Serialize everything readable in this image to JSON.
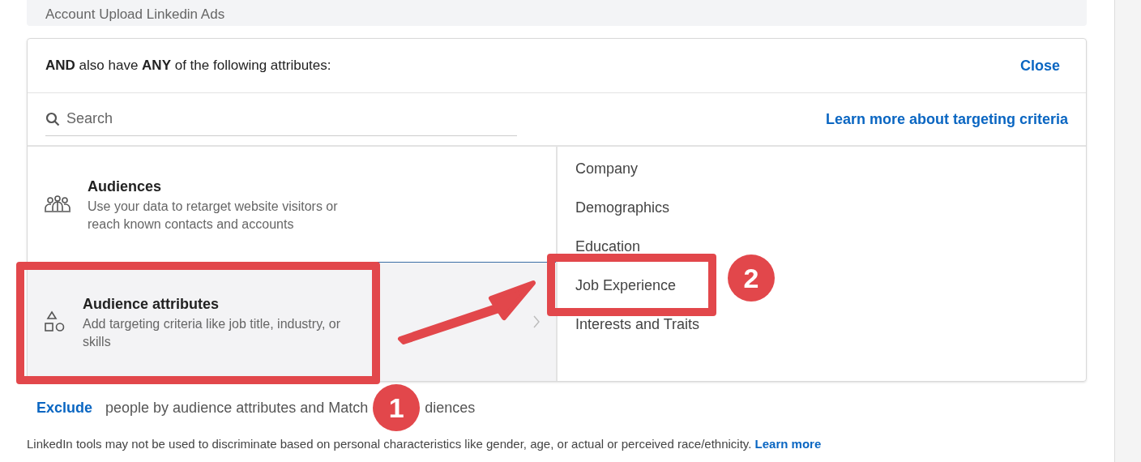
{
  "top_box": {
    "text": "Account Upload Linkedin Ads"
  },
  "panel": {
    "heading": "**AND** also have **ANY** of the following attributes:",
    "close": "Close",
    "search": {
      "placeholder": "Search"
    },
    "learn_more": "Learn more about targeting criteria",
    "categories": [
      {
        "kind": "people",
        "title": "Audiences",
        "description": "Use your data to retarget website visitors or reach known contacts and accounts",
        "selected": false
      },
      {
        "kind": "shapes",
        "title": "Audience attributes",
        "description": "Add targeting criteria like job title, industry, or skills",
        "selected": true
      }
    ],
    "subcategories": [
      "Company",
      "Demographics",
      "Education",
      "Job Experience",
      "Interests and Traits"
    ]
  },
  "exclude": {
    "link": "Exclude",
    "text_before": "people by audience attributes and Match",
    "text_after": "diences"
  },
  "disclaimer": {
    "text": "LinkedIn tools may not be used to discriminate based on personal characteristics like gender, age, or actual or perceived race/ethnicity.",
    "link": "Learn more"
  },
  "annotations": [
    {
      "number": "1"
    },
    {
      "number": "2"
    }
  ]
}
